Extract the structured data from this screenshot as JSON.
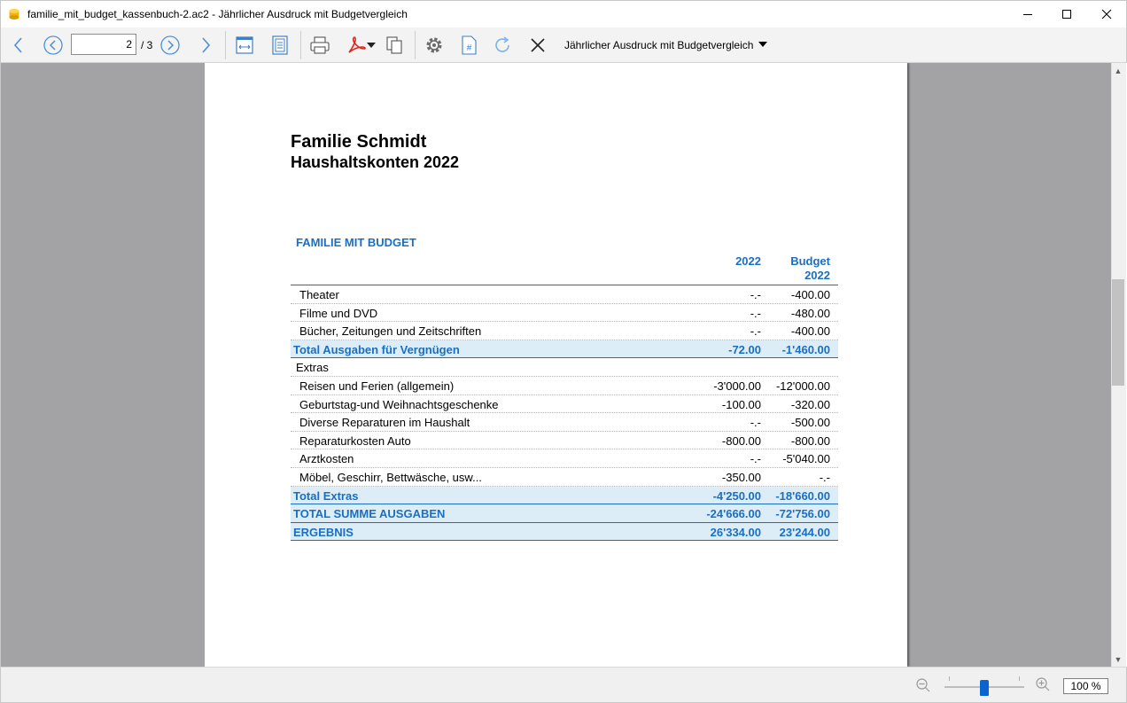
{
  "window": {
    "title": "familie_mit_budget_kassenbuch-2.ac2 - Jährlicher Ausdruck mit Budgetvergleich"
  },
  "toolbar": {
    "page_value": "2",
    "page_total": "/ 3",
    "report_name": "Jährlicher Ausdruck mit Budgetvergleich"
  },
  "report": {
    "title": "Familie Schmidt",
    "subtitle": "Haushaltskonten 2022",
    "heading": "FAMILIE MIT BUDGET",
    "col1": "2022",
    "col2_line1": "Budget",
    "col2_line2": "2022",
    "rows": [
      {
        "type": "item",
        "label": "Theater",
        "v1": "-.-",
        "v2": "-400.00"
      },
      {
        "type": "item",
        "label": "Filme und DVD",
        "v1": "-.-",
        "v2": "-480.00"
      },
      {
        "type": "item",
        "label": "Bücher, Zeitungen und Zeitschriften",
        "v1": "-.-",
        "v2": "-400.00"
      },
      {
        "type": "total",
        "label": "Total Ausgaben für Vergnügen",
        "v1": "-72.00",
        "v2": "-1'460.00"
      },
      {
        "type": "group",
        "label": "Extras",
        "v1": "",
        "v2": ""
      },
      {
        "type": "item",
        "label": "Reisen und Ferien (allgemein)",
        "v1": "-3'000.00",
        "v2": "-12'000.00"
      },
      {
        "type": "item",
        "label": "Geburtstag-und Weihnachtsgeschenke",
        "v1": "-100.00",
        "v2": "-320.00"
      },
      {
        "type": "item",
        "label": "Diverse Reparaturen im Haushalt",
        "v1": "-.-",
        "v2": "-500.00"
      },
      {
        "type": "item",
        "label": "Reparaturkosten Auto",
        "v1": "-800.00",
        "v2": "-800.00"
      },
      {
        "type": "item",
        "label": "Arztkosten",
        "v1": "-.-",
        "v2": "-5'040.00"
      },
      {
        "type": "item",
        "label": "Möbel, Geschirr, Bettwäsche, usw...",
        "v1": "-350.00",
        "v2": "-.-"
      },
      {
        "type": "total",
        "label": "Total Extras",
        "v1": "-4'250.00",
        "v2": "-18'660.00"
      },
      {
        "type": "total",
        "label": "TOTAL SUMME AUSGABEN",
        "v1": "-24'666.00",
        "v2": "-72'756.00"
      },
      {
        "type": "total",
        "label": "ERGEBNIS",
        "v1": "26'334.00",
        "v2": "23'244.00"
      }
    ]
  },
  "statusbar": {
    "zoom": "100 %"
  },
  "icons": {
    "back": "arrow-left-icon",
    "prev_page": "circle-chevron-left-icon",
    "next_page": "circle-chevron-right-icon",
    "forward": "arrow-right-icon",
    "fit_width": "fit-width-icon",
    "fit_page": "fit-page-icon",
    "print": "printer-icon",
    "pdf": "pdf-icon",
    "copy": "copy-icon",
    "settings": "gear-icon",
    "page_number": "page-number-icon",
    "refresh": "refresh-icon",
    "close": "close-icon"
  },
  "colors": {
    "accent": "#1a6fc2",
    "total_bg": "#ddedf7",
    "viewer_bg": "#a3a3a6"
  }
}
